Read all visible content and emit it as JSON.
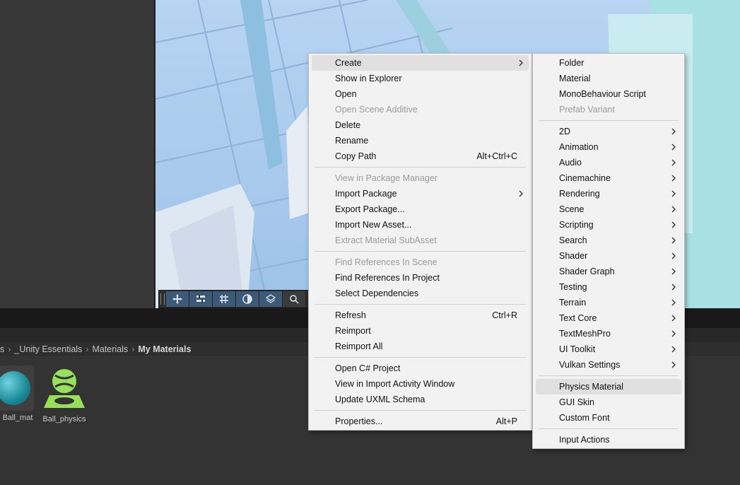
{
  "breadcrumb": {
    "items": [
      "s",
      "_Unity Essentials",
      "Materials",
      "My Materials"
    ]
  },
  "assets": [
    {
      "label": "Ball_mat",
      "icon": "sphere-material-icon"
    },
    {
      "label": "Ball_physics",
      "icon": "physics-material-icon"
    }
  ],
  "scene_toolbar": {
    "tools": [
      "move-tool-icon",
      "transform-tool-icon",
      "grid-tool-icon",
      "shading-tool-icon",
      "layers-tool-icon",
      "search-tool-icon"
    ]
  },
  "context_menu": {
    "groups": [
      [
        {
          "label": "Create",
          "submenu": true,
          "highlighted": true
        },
        {
          "label": "Show in Explorer"
        },
        {
          "label": "Open"
        },
        {
          "label": "Open Scene Additive",
          "disabled": true
        },
        {
          "label": "Delete"
        },
        {
          "label": "Rename"
        },
        {
          "label": "Copy Path",
          "shortcut": "Alt+Ctrl+C"
        }
      ],
      [
        {
          "label": "View in Package Manager",
          "disabled": true
        },
        {
          "label": "Import Package",
          "submenu": true
        },
        {
          "label": "Export Package..."
        },
        {
          "label": "Import New Asset..."
        },
        {
          "label": "Extract Material SubAsset",
          "disabled": true
        }
      ],
      [
        {
          "label": "Find References In Scene",
          "disabled": true
        },
        {
          "label": "Find References In Project"
        },
        {
          "label": "Select Dependencies"
        }
      ],
      [
        {
          "label": "Refresh",
          "shortcut": "Ctrl+R"
        },
        {
          "label": "Reimport"
        },
        {
          "label": "Reimport All"
        }
      ],
      [
        {
          "label": "Open C# Project"
        },
        {
          "label": "View in Import Activity Window"
        },
        {
          "label": "Update UXML Schema"
        }
      ],
      [
        {
          "label": "Properties...",
          "shortcut": "Alt+P"
        }
      ]
    ]
  },
  "create_submenu": {
    "groups": [
      [
        {
          "label": "Folder"
        },
        {
          "label": "Material"
        },
        {
          "label": "MonoBehaviour Script"
        },
        {
          "label": "Prefab Variant",
          "disabled": true
        }
      ],
      [
        {
          "label": "2D",
          "submenu": true
        },
        {
          "label": "Animation",
          "submenu": true
        },
        {
          "label": "Audio",
          "submenu": true
        },
        {
          "label": "Cinemachine",
          "submenu": true
        },
        {
          "label": "Rendering",
          "submenu": true
        },
        {
          "label": "Scene",
          "submenu": true
        },
        {
          "label": "Scripting",
          "submenu": true
        },
        {
          "label": "Search",
          "submenu": true
        },
        {
          "label": "Shader",
          "submenu": true
        },
        {
          "label": "Shader Graph",
          "submenu": true
        },
        {
          "label": "Testing",
          "submenu": true
        },
        {
          "label": "Terrain",
          "submenu": true
        },
        {
          "label": "Text Core",
          "submenu": true
        },
        {
          "label": "TextMeshPro",
          "submenu": true
        },
        {
          "label": "UI Toolkit",
          "submenu": true
        },
        {
          "label": "Vulkan Settings",
          "submenu": true
        }
      ],
      [
        {
          "label": "Physics Material",
          "highlighted": true
        },
        {
          "label": "GUI Skin"
        },
        {
          "label": "Custom Font"
        }
      ],
      [
        {
          "label": "Input Actions"
        }
      ]
    ]
  }
}
